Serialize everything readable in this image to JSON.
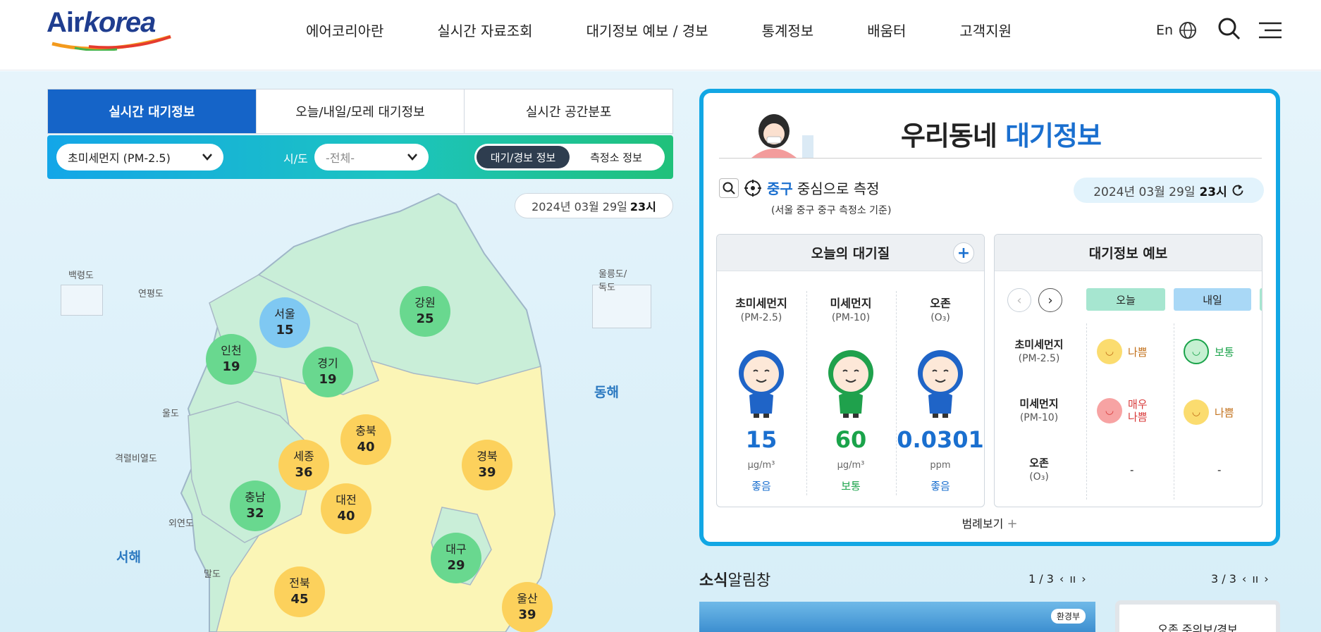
{
  "header": {
    "logo_text_a": "Air",
    "logo_text_b": "korea",
    "nav": [
      "에어코리아란",
      "실시간 자료조회",
      "대기정보 예보 / 경보",
      "통계정보",
      "배움터",
      "고객지원"
    ],
    "lang": "En"
  },
  "map_panel": {
    "tabs": [
      "실시간 대기정보",
      "오늘/내일/모레 대기정보",
      "실시간 공간분포"
    ],
    "pollutant_select": "초미세먼지 (PM-2.5)",
    "sido_label": "시/도",
    "sido_select": "-전체-",
    "toggle": [
      "대기/경보 정보",
      "측정소 정보"
    ],
    "date": "2024년 03월 29일",
    "hour": "23시",
    "seas": [
      "동해",
      "서해"
    ],
    "islands": [
      "백령도",
      "연평도",
      "울릉도/독도",
      "울도",
      "격렬비열도",
      "외연도",
      "말도"
    ],
    "cities": [
      {
        "name": "서울",
        "value": "15",
        "grade": "blue"
      },
      {
        "name": "인천",
        "value": "19",
        "grade": "green"
      },
      {
        "name": "경기",
        "value": "19",
        "grade": "green"
      },
      {
        "name": "강원",
        "value": "25",
        "grade": "green"
      },
      {
        "name": "충북",
        "value": "40",
        "grade": "yellow"
      },
      {
        "name": "세종",
        "value": "36",
        "grade": "yellow"
      },
      {
        "name": "경북",
        "value": "39",
        "grade": "yellow"
      },
      {
        "name": "충남",
        "value": "32",
        "grade": "green"
      },
      {
        "name": "대전",
        "value": "40",
        "grade": "yellow"
      },
      {
        "name": "대구",
        "value": "29",
        "grade": "green"
      },
      {
        "name": "전북",
        "value": "45",
        "grade": "yellow"
      },
      {
        "name": "울산",
        "value": "39",
        "grade": "yellow"
      }
    ]
  },
  "neighborhood": {
    "title_a": "우리동네",
    "title_b": "대기정보",
    "loc_name": "중구",
    "loc_rest": "중심으로 측정",
    "loc_sub": "(서울 중구 중구 측정소 기준)",
    "date": "2024년 03월 29일",
    "hour": "23시",
    "today_title": "오늘의 대기질",
    "measures": [
      {
        "name": "초미세먼지",
        "unit": "(PM-2.5)",
        "value": "15",
        "u": "μg/m³",
        "grade": "좋음",
        "color": "#1a6fcf"
      },
      {
        "name": "미세먼지",
        "unit": "(PM-10)",
        "value": "60",
        "u": "μg/m³",
        "grade": "보통",
        "color": "#1aa34a"
      },
      {
        "name": "오존",
        "unit": "(O₃)",
        "value": "0.0301",
        "u": "ppm",
        "grade": "좋음",
        "color": "#1a6fcf"
      }
    ],
    "forecast_title": "대기정보 예보",
    "forecast_days": [
      "오늘",
      "내일"
    ],
    "forecast_rows": [
      {
        "name": "초미세먼지",
        "unit": "(PM-2.5)",
        "today": "나쁨",
        "tomorrow": "보통"
      },
      {
        "name": "미세먼지",
        "unit": "(PM-10)",
        "today": "매우 나쁨",
        "tomorrow": "나쁨"
      },
      {
        "name": "오존",
        "unit": "(O₃)",
        "today": "-",
        "tomorrow": "-"
      }
    ],
    "legend": "범례보기"
  },
  "news": {
    "title_a": "소식",
    "title_b": "알림창",
    "pager_a": "1 / 3",
    "pager_b": "3 / 3",
    "banner_org": "환경부",
    "ozone_box": "오존 주의보/경보"
  }
}
